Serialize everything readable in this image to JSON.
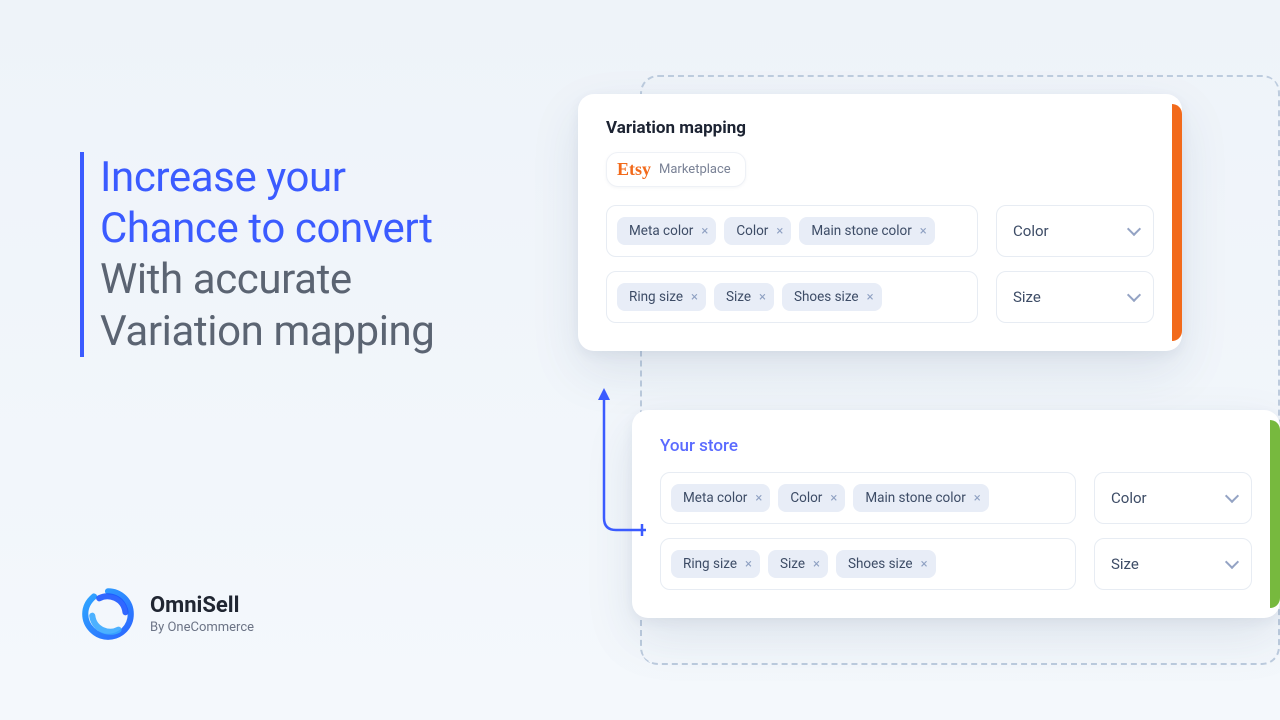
{
  "headline": {
    "line1": "Increase your",
    "line2": "Chance to convert",
    "line3": "With accurate",
    "line4": "Variation mapping"
  },
  "brand": {
    "title": "OmniSell",
    "byline": "By OneCommerce"
  },
  "cards": {
    "top": {
      "title": "Variation mapping",
      "source_logo": "Etsy",
      "source_label": "Marketplace",
      "rows": [
        {
          "tags": [
            "Meta color",
            "Color",
            "Main stone color"
          ],
          "select": "Color"
        },
        {
          "tags": [
            "Ring size",
            "Size",
            "Shoes size"
          ],
          "select": "Size"
        }
      ]
    },
    "bottom": {
      "store_label": "Your store",
      "rows": [
        {
          "tags": [
            "Meta color",
            "Color",
            "Main stone color"
          ],
          "select": "Color"
        },
        {
          "tags": [
            "Ring size",
            "Size",
            "Shoes size"
          ],
          "select": "Size"
        }
      ]
    }
  },
  "colors": {
    "accent_blue": "#3b5bff",
    "etsy_orange": "#f26a1b",
    "store_green": "#77b93e"
  }
}
